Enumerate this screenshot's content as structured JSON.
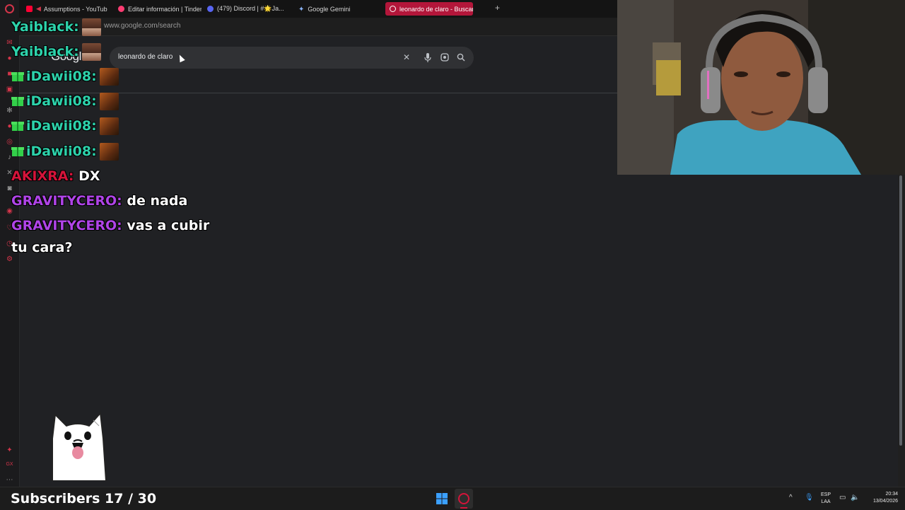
{
  "browser": {
    "tabs": [
      {
        "label": "Assumptions - YouTub"
      },
      {
        "label": "Editar información | Tinder"
      },
      {
        "label": "(479) Discord | #🌟Ja..."
      },
      {
        "label": "Google Gemini"
      },
      {
        "label": "leonardo de claro - Buscar"
      }
    ],
    "url": "www.google.com/search"
  },
  "google": {
    "logo": "Googl",
    "query": "leonardo de claro"
  },
  "chat": [
    {
      "user": "Yaiblack:",
      "message": ""
    },
    {
      "user": "Yaiblack:",
      "message": ""
    },
    {
      "user": "iDawii08:",
      "message": ""
    },
    {
      "user": "iDawii08:",
      "message": ""
    },
    {
      "user": "iDawii08:",
      "message": ""
    },
    {
      "user": "iDawii08:",
      "message": ""
    },
    {
      "user": "AKIXRA:",
      "message": "DX"
    },
    {
      "user": "GRAVITYCERO:",
      "message": "de nada"
    },
    {
      "user": "GRAVITYCERO:",
      "message": "vas a cubir"
    },
    {
      "user": "",
      "message": "tu cara?"
    }
  ],
  "overlay": {
    "subscribers": "Subscribers 17 / 30"
  },
  "tray": {
    "lang_top": "ESP",
    "lang_bottom": "LAA",
    "time": "20:34",
    "date": "13/04/2026"
  },
  "colors": {
    "accent": "#b3163a",
    "chat_teal": "#2dd2ab",
    "chat_red": "#d4143a",
    "chat_purple": "#b044e8"
  }
}
